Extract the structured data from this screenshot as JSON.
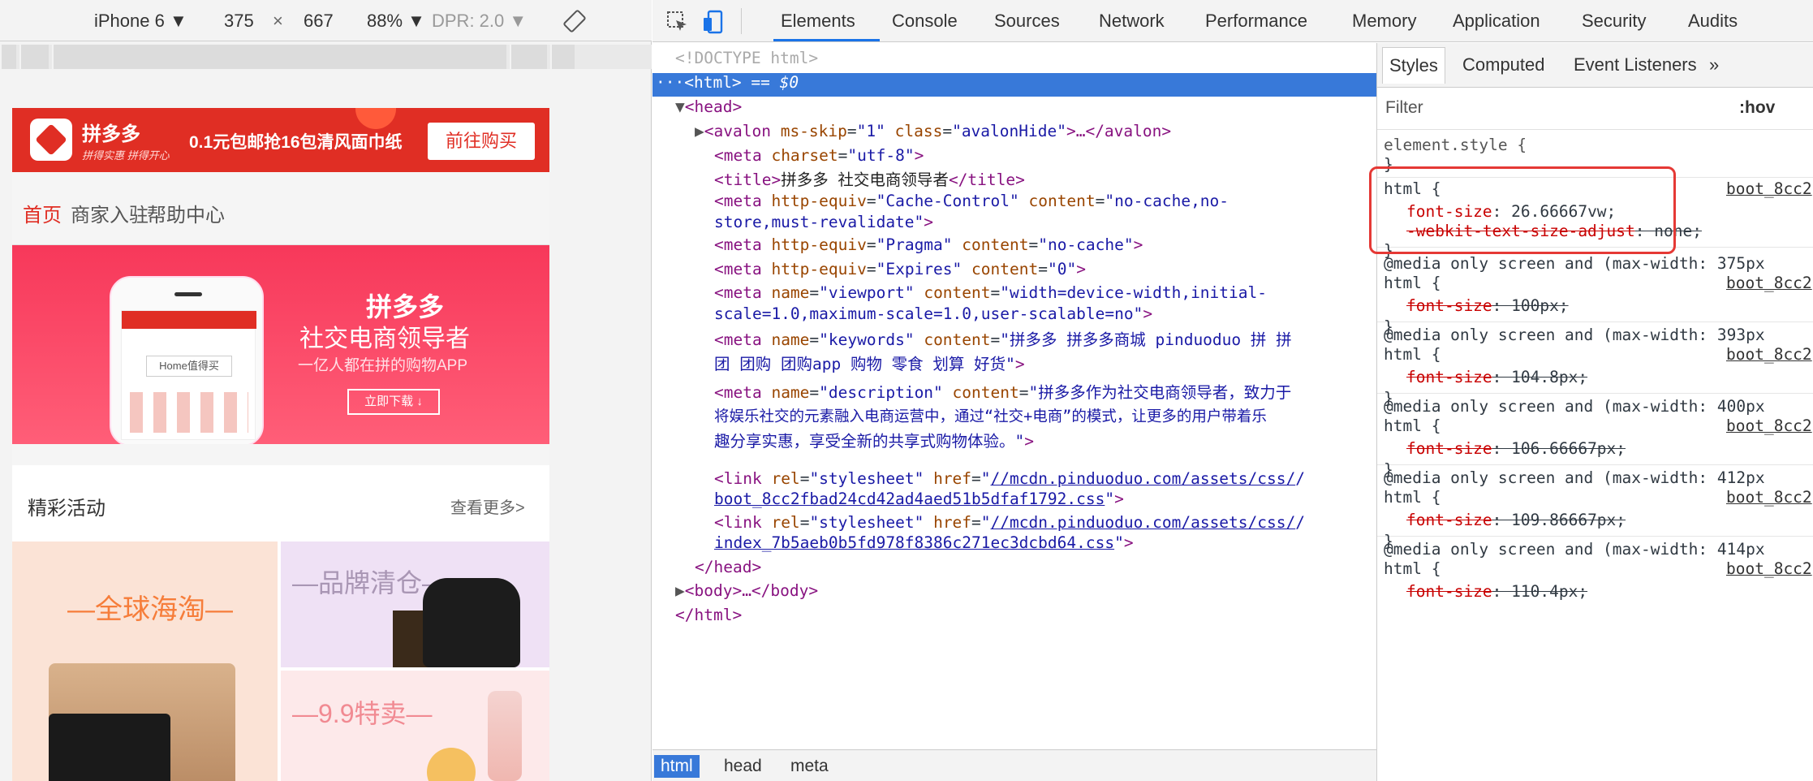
{
  "device_toolbar": {
    "device": "iPhone 6 ▼",
    "width": "375",
    "times": "×",
    "height": "667",
    "zoom": "88% ▼",
    "dpr": "DPR: 2.0 ▼",
    "rotate_icon": "rotate-icon"
  },
  "page": {
    "promo": {
      "brand": "拼多多",
      "slogan": "拼得实惠 拼得开心",
      "offer": "0.1元包邮抢16包清风面巾纸",
      "buy_label": "前往购买"
    },
    "nav": [
      "首页",
      "商家入驻",
      "帮助中心"
    ],
    "banner": {
      "title": "拼多多",
      "subtitle": "社交电商领导者",
      "tagline": "一亿人都在拼的购物APP",
      "download": "立即下载 ↓",
      "mock_label": "Home值得买"
    },
    "section": {
      "title": "精彩活动",
      "more": "查看更多>"
    },
    "tiles": {
      "global": "—全球海淘—",
      "brand": "—品牌清仓—",
      "sale": "—9.9特卖—"
    }
  },
  "devtools": {
    "tabs": [
      "Elements",
      "Console",
      "Sources",
      "Network",
      "Performance",
      "Memory",
      "Application",
      "Security",
      "Audits"
    ],
    "active_tab": "Elements",
    "dom": {
      "doctype": "<!DOCTYPE html>",
      "html_open_prefix": "···",
      "html_open_tag": "<html>",
      "html_open_suffix": " == $0",
      "head_open": "<head>",
      "avalon_tag": "avalon",
      "avalon_attr1": "ms-skip",
      "avalon_val1": "\"1\"",
      "avalon_attr2": "class",
      "avalon_val2": "\"avalonHide\"",
      "avalon_ellipsis": ">…</avalon>",
      "meta_charset_attr": "charset",
      "meta_charset_val": "\"utf-8\"",
      "title_text": "拼多多 社交电商领导者",
      "cache_attr": "http-equiv",
      "cache_val": "\"Cache-Control\"",
      "cache_content_attr": "content",
      "cache_content_val1": "\"no-cache,no-",
      "cache_content_val2": "store,must-revalidate\"",
      "pragma_val": "\"Pragma\"",
      "pragma_content": "\"no-cache\"",
      "expires_val": "\"Expires\"",
      "expires_content": "\"0\"",
      "viewport_name": "\"viewport\"",
      "viewport_content1": "\"width=device-width,initial-",
      "viewport_content2": "scale=1.0,maximum-scale=1.0,user-scalable=no\"",
      "keywords_name": "\"keywords\"",
      "keywords_content1": "\"拼多多 拼多多商城 pinduoduo 拼 拼",
      "keywords_content2": "团 团购 团购app 购物 零食 划算 好货\"",
      "desc_name": "\"description\"",
      "desc_content1": "\"拼多多作为社交电商领导者，致力于",
      "desc_content2": "将娱乐社交的元素融入电商运营中，通过“社交+电商”的模式，让更多的用户带着乐",
      "desc_content3": "趣分享实惠，享受全新的共享式购物体验。\"",
      "link1_rel": "\"stylesheet\"",
      "link1_href1": "//mcdn.pinduoduo.com/assets/css/",
      "link1_href2": "boot_8cc2fbad24cd42ad4aed51b5dfaf1792.css",
      "link2_href1": "//mcdn.pinduoduo.com/assets/css/",
      "link2_href2": "index_7b5aeb0b5fd978f8386c271ec3dcbd64.css",
      "head_close": "</head>",
      "body_collapsed": "<body>…</body>",
      "html_close": "</html>"
    },
    "breadcrumbs": [
      "html",
      "head",
      "meta"
    ],
    "styles": {
      "tabs": [
        "Styles",
        "Computed",
        "Event Listeners",
        "»"
      ],
      "filter_placeholder": "Filter",
      "hov": ":hov",
      "element_style": "element.style {",
      "close": "}",
      "rules": [
        {
          "selector": "html {",
          "source": "boot_8cc2",
          "prop": "font-size",
          "value": ": 26.66667vw;",
          "prop2": "-webkit-text-size-adjust",
          "value2": ": none;"
        },
        {
          "media": "@media only screen and (max-width: 375px",
          "selector": "html {",
          "source": "boot_8cc2",
          "prop": "font-size",
          "value": ": 100px;"
        },
        {
          "media": "@media only screen and (max-width: 393px",
          "selector": "html {",
          "source": "boot_8cc2",
          "prop": "font-size",
          "value": ": 104.8px;"
        },
        {
          "media": "@media only screen and (max-width: 400px",
          "selector": "html {",
          "source": "boot_8cc2",
          "prop": "font-size",
          "value": ": 106.66667px;"
        },
        {
          "media": "@media only screen and (max-width: 412px",
          "selector": "html {",
          "source": "boot_8cc2",
          "prop": "font-size",
          "value": ": 109.86667px;"
        },
        {
          "media": "@media only screen and (max-width: 414px",
          "selector": "html {",
          "source": "boot_8cc2",
          "prop": "font-size",
          "value": ": 110.4px;"
        }
      ]
    },
    "colors": {
      "accent": "#1a73e8",
      "selection": "#3879d9",
      "brand_red": "#e02e24",
      "highlight": "#e53935"
    }
  }
}
